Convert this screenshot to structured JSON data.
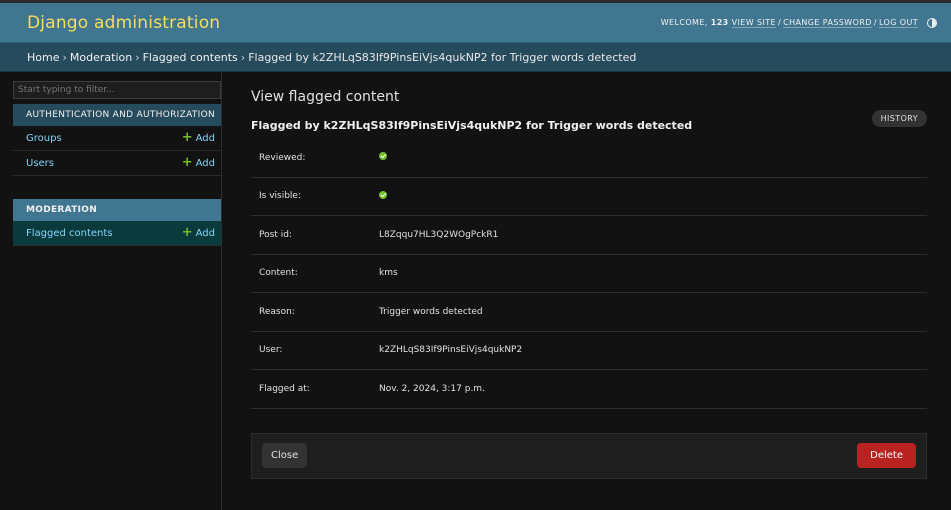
{
  "header": {
    "site_name": "Django administration",
    "welcome": "Welcome,",
    "username": "123",
    "view_site": "View site",
    "change_password": "Change password",
    "log_out": "Log out",
    "sep": "/",
    "theme_icon": "theme-toggle-icon"
  },
  "breadcrumbs": {
    "home": "Home",
    "app": "Moderation",
    "model": "Flagged contents",
    "current": "Flagged by k2ZHLqS83If9PinsEiVjs4qukNP2 for Trigger words detected",
    "sep": "›"
  },
  "sidebar": {
    "filter_placeholder": "Start typing to filter...",
    "modules": [
      {
        "caption": "Authentication and Authorization",
        "rows": [
          {
            "label": "Groups",
            "add": "Add"
          },
          {
            "label": "Users",
            "add": "Add"
          }
        ]
      },
      {
        "caption": "Moderation",
        "rows": [
          {
            "label": "Flagged contents",
            "add": "Add"
          }
        ]
      }
    ]
  },
  "content": {
    "title": "View flagged content",
    "subtitle": "Flagged by k2ZHLqS83If9PinsEiVjs4qukNP2 for Trigger words detected",
    "history": "History",
    "fields": [
      {
        "label": "Reviewed:",
        "value": "",
        "icon": "check-icon"
      },
      {
        "label": "Is visible:",
        "value": "",
        "icon": "check-icon"
      },
      {
        "label": "Post id:",
        "value": "L8Zqqu7HL3Q2WOgPckR1"
      },
      {
        "label": "Content:",
        "value": "kms"
      },
      {
        "label": "Reason:",
        "value": "Trigger words detected"
      },
      {
        "label": "User:",
        "value": "k2ZHLqS83If9PinsEiVjs4qukNP2"
      },
      {
        "label": "Flagged at:",
        "value": "Nov. 2, 2024, 3:17 p.m."
      }
    ],
    "close": "Close",
    "delete": "Delete"
  },
  "colors": {
    "header_bg": "#417690",
    "site_name": "#f5dd5d",
    "breadcrumbs_bg": "#264b5d",
    "link": "#81d4fa",
    "add_plus": "#70bf2b",
    "delete_bg": "#ba2121",
    "current_row_bg": "#0b3a3d"
  }
}
